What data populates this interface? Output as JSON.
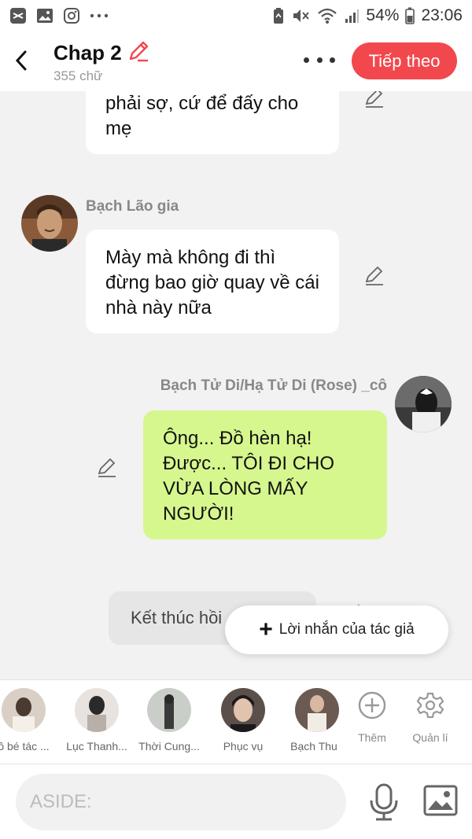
{
  "status_bar": {
    "battery": "54%",
    "time": "23:06"
  },
  "header": {
    "title": "Chap 2",
    "word_count": "355 chữ",
    "next_label": "Tiếp theo"
  },
  "messages": [
    {
      "text": "phải sợ, cứ để đấy cho mẹ"
    },
    {
      "speaker": "Bạch Lão gia",
      "text": "Mày mà không đi thì đừng bao giờ quay về cái nhà này nữa"
    },
    {
      "speaker": "Bạch Tử Di/Hạ Tử Di (Rose) _cô",
      "text": "Ông... Đồ hèn hạ! Được... TÔI ĐI CHO VỪA LÒNG MẤY NGƯỜI!"
    },
    {
      "text": "Kết thúc hồi"
    }
  ],
  "author_note_label": "Lời nhắn của tác giả",
  "characters": [
    {
      "name": "ô bé tác ..."
    },
    {
      "name": "Lục Thanh..."
    },
    {
      "name": "Thời Cung..."
    },
    {
      "name": "Phục vụ"
    },
    {
      "name": "Bạch Thu"
    }
  ],
  "tools": {
    "add_label": "Thêm",
    "manage_label": "Quản lí"
  },
  "input": {
    "placeholder": "ASIDE:"
  },
  "colors": {
    "accent": "#f2484d",
    "own_bubble": "#d6f78e",
    "other_bubble": "#ffffff"
  }
}
